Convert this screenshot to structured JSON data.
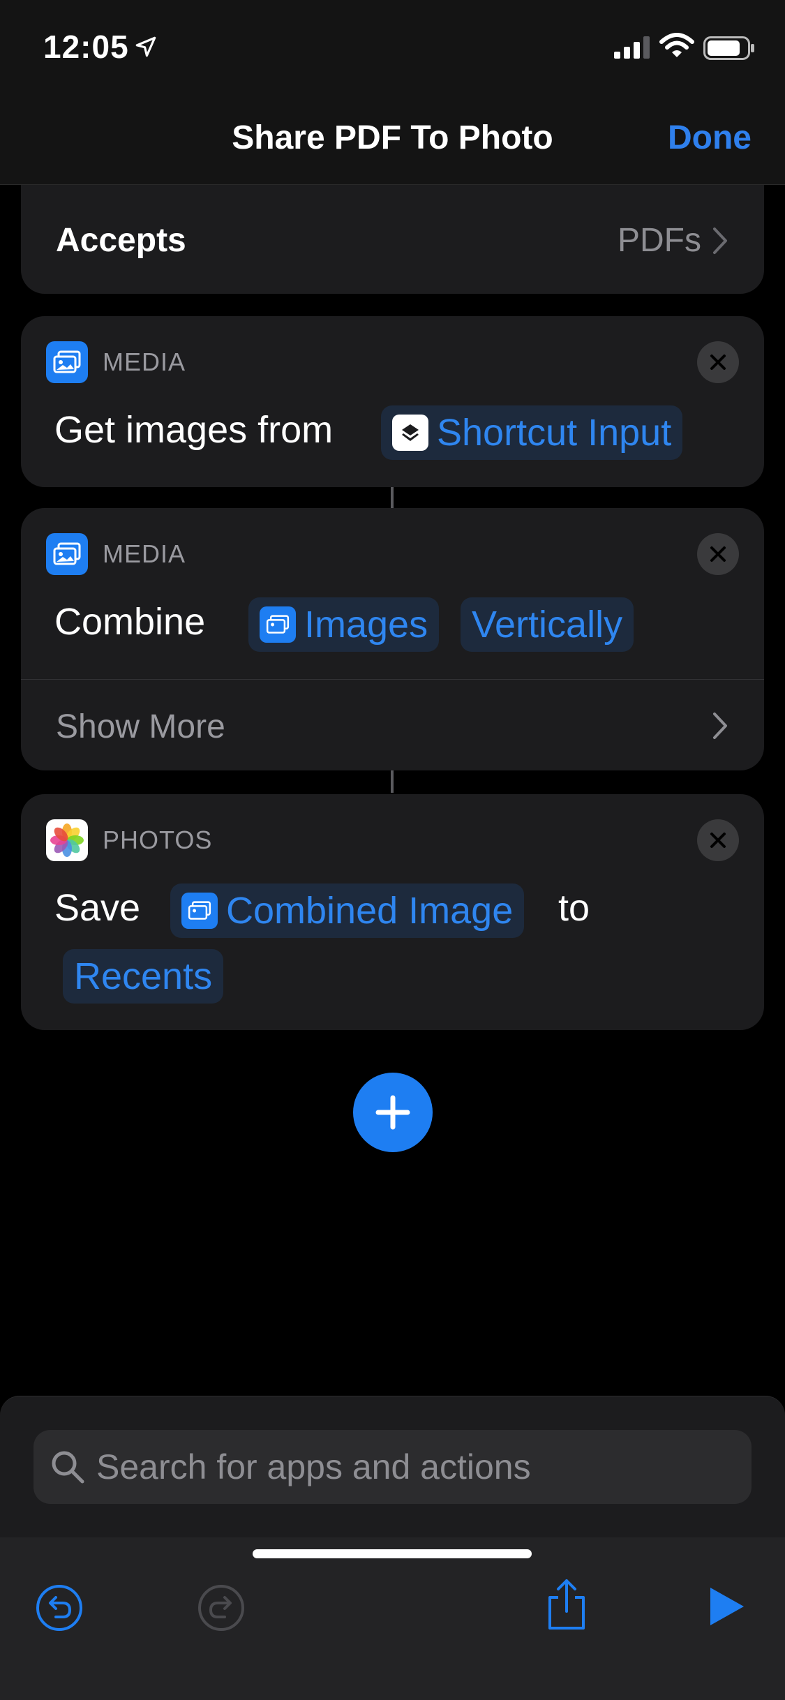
{
  "status_bar": {
    "time": "12:05"
  },
  "nav": {
    "title": "Share PDF To Photo",
    "done_label": "Done"
  },
  "accepts": {
    "label": "Accepts",
    "value": "PDFs"
  },
  "actions": [
    {
      "category": "MEDIA",
      "text": "Get images from",
      "token": "Shortcut Input"
    },
    {
      "category": "MEDIA",
      "text": "Combine",
      "token1": "Images",
      "token2": "Vertically",
      "show_more": "Show More"
    },
    {
      "category": "PHOTOS",
      "text": "Save",
      "token1": "Combined Image",
      "connector_word": "to",
      "token2": "Recents"
    }
  ],
  "search": {
    "placeholder": "Search for apps and actions"
  },
  "colors": {
    "accent": "#1e7ef2",
    "background": "#000000",
    "card": "#1c1c1e"
  }
}
